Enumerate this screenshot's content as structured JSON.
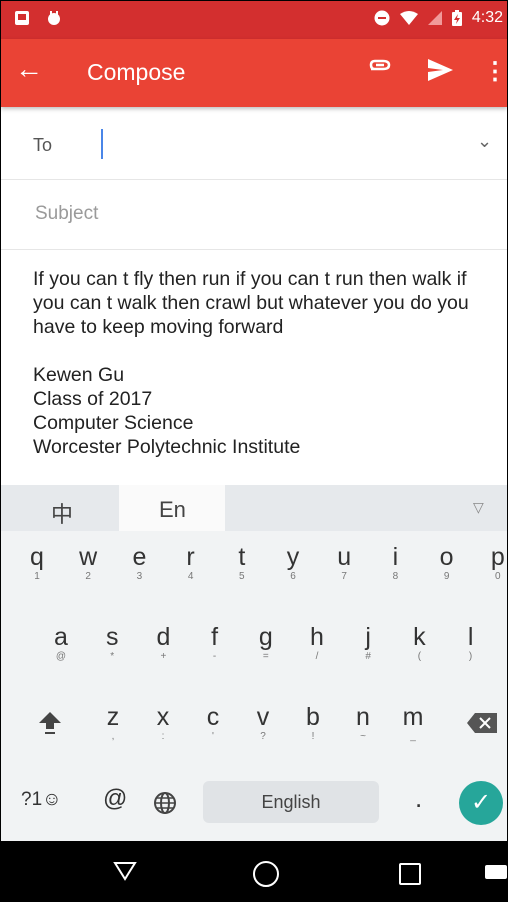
{
  "status_bar": {
    "time": "4:32"
  },
  "app_bar": {
    "title": "Compose",
    "back_icon": "arrow-left-icon",
    "attach_icon": "paperclip-icon",
    "send_icon": "send-icon",
    "more_icon": "more-vert-icon"
  },
  "to": {
    "label": "To",
    "value": ""
  },
  "subject": {
    "placeholder": "Subject",
    "value": ""
  },
  "body": "If you can t fly then run if you can t run then walk if you can t walk then crawl but whatever you do you have to keep moving forward\n\nKewen Gu\nClass of 2017\nComputer Science\nWorcester Polytechnic Institute",
  "keyboard": {
    "tab_zh": "中",
    "tab_en": "En",
    "collapse": "▽",
    "row1": [
      {
        "k": "q",
        "h": "1"
      },
      {
        "k": "w",
        "h": "2"
      },
      {
        "k": "e",
        "h": "3"
      },
      {
        "k": "r",
        "h": "4"
      },
      {
        "k": "t",
        "h": "5"
      },
      {
        "k": "y",
        "h": "6"
      },
      {
        "k": "u",
        "h": "7"
      },
      {
        "k": "i",
        "h": "8"
      },
      {
        "k": "o",
        "h": "9"
      },
      {
        "k": "p",
        "h": "0"
      }
    ],
    "row2": [
      {
        "k": "a",
        "h": "@"
      },
      {
        "k": "s",
        "h": "*"
      },
      {
        "k": "d",
        "h": "+"
      },
      {
        "k": "f",
        "h": "-"
      },
      {
        "k": "g",
        "h": "="
      },
      {
        "k": "h",
        "h": "/"
      },
      {
        "k": "j",
        "h": "#"
      },
      {
        "k": "k",
        "h": "("
      },
      {
        "k": "l",
        "h": ")"
      }
    ],
    "row3": [
      {
        "k": "z",
        "h": ","
      },
      {
        "k": "x",
        "h": ":"
      },
      {
        "k": "c",
        "h": "'"
      },
      {
        "k": "v",
        "h": "?"
      },
      {
        "k": "b",
        "h": "!"
      },
      {
        "k": "n",
        "h": "~"
      },
      {
        "k": "m",
        "h": "_"
      }
    ],
    "sym_label": "?1☺",
    "at_label": "@",
    "space_label": "English",
    "period_label": ".",
    "enter_icon": "check-icon"
  }
}
